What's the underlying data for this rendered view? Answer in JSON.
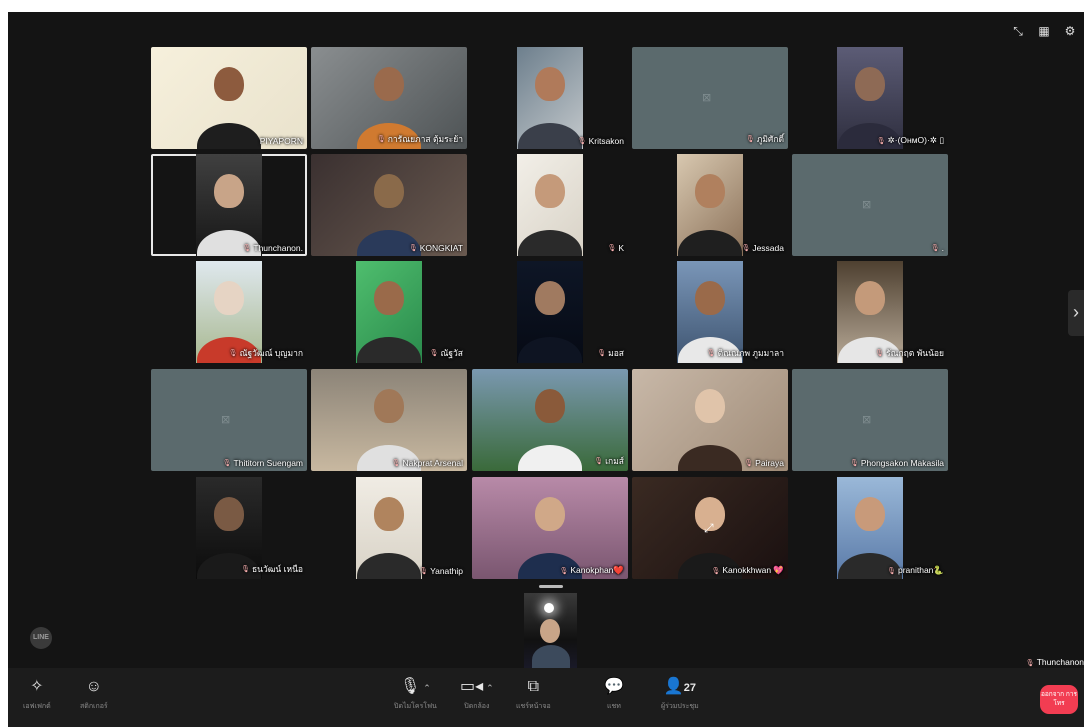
{
  "participants": [
    {
      "name": "PIYAPORN",
      "cam": true,
      "muted": false,
      "bg": "linear-gradient(135deg,#f6f0dc,#e9e2cc)",
      "skin": "#8d5b3e",
      "shirt": "#1e1e1e"
    },
    {
      "name": "การัณยภาส ตุ้มระย้า",
      "cam": true,
      "muted": true,
      "bg": "linear-gradient(135deg,#8a8e90,#4e5355)",
      "skin": "#9a6a4c",
      "shirt": "#d07a30"
    },
    {
      "name": "Kritsakon",
      "cam": true,
      "muted": true,
      "bg": "linear-gradient(135deg,#6d7f8d,#c4c9cc)",
      "skin": "#b07a5a",
      "shirt": "#3a3f4a"
    },
    {
      "name": "ภูมิศักดิ์",
      "cam": false,
      "muted": true
    },
    {
      "name": "✲·(OʜᴍO)·✲ ▯",
      "cam": true,
      "muted": true,
      "bg": "linear-gradient(180deg,#5c5c76,#2e2e3e)",
      "skin": "#8e6a55",
      "shirt": "#2b2b3c"
    },
    {
      "name": "Thunchanon.",
      "cam": true,
      "muted": true,
      "bg": "linear-gradient(180deg,#404040,#161616)",
      "skin": "#c8a488",
      "shirt": "#e0e0e0",
      "selected": true
    },
    {
      "name": "KONGKIAT",
      "cam": true,
      "muted": true,
      "bg": "linear-gradient(135deg,#3a3030,#6a5a50)",
      "skin": "#8a6a4a",
      "shirt": "#2a3a5a"
    },
    {
      "name": "K",
      "cam": true,
      "muted": true,
      "bg": "linear-gradient(135deg,#f2efe8,#d8d2c6)",
      "skin": "#c59a7a",
      "shirt": "#2a2a2a"
    },
    {
      "name": "Jessada",
      "cam": true,
      "muted": true,
      "bg": "linear-gradient(135deg,#d8c8b0,#8a7058)",
      "skin": "#b0805e",
      "shirt": "#1f1f1f"
    },
    {
      "name": ".",
      "cam": false,
      "muted": true
    },
    {
      "name": "ณัฐวัฒณ์ บุญมาก",
      "cam": true,
      "muted": true,
      "bg": "linear-gradient(180deg,#dfe8ee,#a8b890)",
      "skin": "#e6d4c4",
      "shirt": "#c83a2a"
    },
    {
      "name": "ณัฐวัส",
      "cam": true,
      "muted": true,
      "bg": "linear-gradient(135deg,#4fbe6e,#2a8a4c)",
      "skin": "#9a6a4a",
      "shirt": "#2a2a2a"
    },
    {
      "name": "มอส",
      "cam": true,
      "muted": true,
      "bg": "linear-gradient(180deg,#0e1626,#060a14)",
      "skin": "#a07a60",
      "shirt": "#0e1422"
    },
    {
      "name": "ติณณภพ ภูมมาลา",
      "cam": true,
      "muted": true,
      "bg": "linear-gradient(180deg,#7a96b8,#3e5470)",
      "skin": "#9a6a4a",
      "shirt": "#e8e8e8"
    },
    {
      "name": "รัณกฤต พันน้อย",
      "cam": true,
      "muted": true,
      "bg": "linear-gradient(180deg,#4e4030,#b8aa98)",
      "skin": "#c49a7a",
      "shirt": "#e6e6e6"
    },
    {
      "name": "Thititorn Suengam",
      "cam": false,
      "muted": true
    },
    {
      "name": "Nakprat Arsenal",
      "cam": true,
      "muted": true,
      "bg": "linear-gradient(180deg,#8c8478,#c8b8a0)",
      "skin": "#a07858",
      "shirt": "#e0e0e0"
    },
    {
      "name": "เกมส์",
      "cam": true,
      "muted": true,
      "bg": "linear-gradient(180deg,#7a98b0,#3a6a3a)",
      "skin": "#8a5a3a",
      "shirt": "#f0f0f0"
    },
    {
      "name": "Pairaya",
      "cam": true,
      "muted": true,
      "bg": "linear-gradient(135deg,#c8b8a8,#a08c78)",
      "skin": "#e0c4aa",
      "shirt": "#3a2a22"
    },
    {
      "name": "Phongsakon Makasila",
      "cam": false,
      "muted": true
    },
    {
      "name": "ธนวัฒน์ เหนือ",
      "cam": true,
      "muted": true,
      "bg": "linear-gradient(180deg,#2a2a2a,#0c0c0c)",
      "skin": "#7a5a44",
      "shirt": "#1a1a1a"
    },
    {
      "name": "Yanathip",
      "cam": true,
      "muted": true,
      "bg": "linear-gradient(180deg,#f0ece4,#d8d2c6)",
      "skin": "#b0845e",
      "shirt": "#2a2a2a"
    },
    {
      "name": "Kanokphan❤️",
      "cam": true,
      "muted": true,
      "bg": "linear-gradient(180deg,#b88aa8,#7a5670)",
      "skin": "#d0a888",
      "shirt": "#1e2e4e"
    },
    {
      "name": "Kanokkhwan 💖",
      "cam": true,
      "muted": true,
      "bg": "linear-gradient(135deg,#3a2a22,#1a1010)",
      "skin": "#d8b090",
      "shirt": "#1a1a1a",
      "expand": true
    },
    {
      "name": "pranithan🐍",
      "cam": true,
      "muted": true,
      "bg": "linear-gradient(180deg,#9ab8d8,#5a7aa8)",
      "skin": "#c89a7a",
      "shirt": "#2a2a2a"
    }
  ],
  "self": {
    "name": "Thunchanon"
  },
  "toolbar": {
    "effects": "เอฟเฟกต์",
    "stickers": "สติกเกอร์",
    "mic": "ปิดไมโครโฟน",
    "camera": "ปิดกล้อง",
    "share": "แชร์หน้าจอ",
    "chat": "แชท",
    "members_label": "ผู้ร่วมประชุม",
    "members_count": "27",
    "leave": "ออกจาก การโทร"
  },
  "logo": "LINE"
}
